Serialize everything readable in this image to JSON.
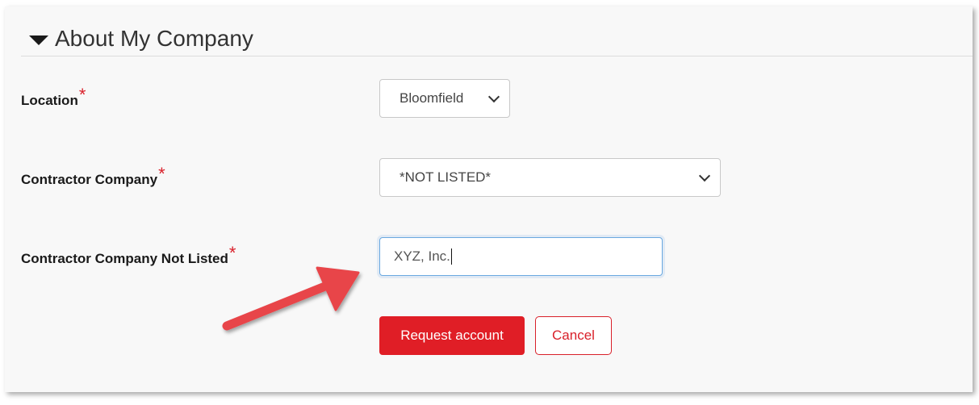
{
  "section": {
    "title": "About My Company"
  },
  "fields": {
    "location": {
      "label": "Location",
      "required_mark": "*",
      "value": "Bloomfield"
    },
    "contractor_company": {
      "label": "Contractor Company",
      "required_mark": "*",
      "value": "*NOT LISTED*"
    },
    "contractor_company_not_listed": {
      "label": "Contractor Company Not Listed",
      "required_mark": "*",
      "value": "XYZ, Inc."
    }
  },
  "actions": {
    "request_label": "Request account",
    "cancel_label": "Cancel"
  },
  "icons": {
    "section_toggle": "caret-down-icon",
    "select_dropdown": "chevron-down-icon",
    "annotation": "arrow-annotation-icon"
  },
  "colors": {
    "brand_red": "#e01e26",
    "required_star": "#d9202a",
    "focus_border": "#6aa8e0",
    "arrow": "#e8454a"
  }
}
